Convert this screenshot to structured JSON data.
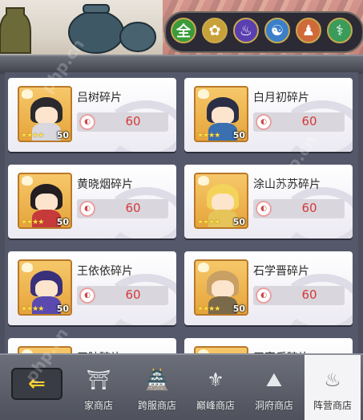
{
  "filters": [
    {
      "glyph": "全",
      "color": "#3a9b3a",
      "icon": "all-icon"
    },
    {
      "glyph": "✿",
      "color": "#c9a13a",
      "icon": "lotus-icon"
    },
    {
      "glyph": "♨",
      "color": "#5a3fb0",
      "icon": "flame-icon"
    },
    {
      "glyph": "☯",
      "color": "#3a7fc9",
      "icon": "swirl-icon"
    },
    {
      "glyph": "♟",
      "color": "#d06a3a",
      "icon": "fire-figure-icon"
    },
    {
      "glyph": "⚕",
      "color": "#3a9b5a",
      "icon": "dna-icon"
    }
  ],
  "cards": [
    {
      "name": "吕树碎片",
      "price": "60",
      "level": "50",
      "stars": "★★★★",
      "hair": "#2a2a2e",
      "body": "#d8d8de"
    },
    {
      "name": "白月初碎片",
      "price": "60",
      "level": "50",
      "stars": "★★★★",
      "hair": "#2a2f45",
      "body": "#3a6fb0"
    },
    {
      "name": "黄晓烟碎片",
      "price": "60",
      "level": "50",
      "stars": "★★★★",
      "hair": "#241d22",
      "body": "#c63a3a"
    },
    {
      "name": "涂山苏苏碎片",
      "price": "60",
      "level": "50",
      "stars": "★★★★",
      "hair": "#f3d35a",
      "body": "#e6c45a"
    },
    {
      "name": "王依依碎片",
      "price": "60",
      "level": "50",
      "stars": "★★★★",
      "hair": "#3a2f7a",
      "body": "#5a4ab0"
    },
    {
      "name": "石学晋碎片",
      "price": "60",
      "level": "50",
      "stars": "★★★★",
      "hair": "#c9a064",
      "body": "#7a6a4a"
    },
    {
      "name": "王陆碎片",
      "price": "",
      "level": "",
      "stars": "",
      "hair": "#7a6a8a",
      "body": "#999"
    },
    {
      "name": "王家乐碎片",
      "price": "",
      "level": "",
      "stars": "",
      "hair": "#7a6a8a",
      "body": "#999"
    }
  ],
  "coin_glyph": "◐",
  "nav": {
    "back_glyph": "⇐",
    "tabs": [
      {
        "label": "家商店",
        "icon": "shop-icon",
        "glyph": "⛩"
      },
      {
        "label": "跨服商店",
        "icon": "cross-server-icon",
        "glyph": "🏯"
      },
      {
        "label": "巅峰商店",
        "icon": "peak-icon",
        "glyph": "⚜"
      },
      {
        "label": "洞府商店",
        "icon": "cave-icon",
        "glyph": "⛰"
      },
      {
        "label": "阵营商店",
        "icon": "faction-icon",
        "glyph": "♨"
      }
    ]
  },
  "watermark": "php.cn"
}
